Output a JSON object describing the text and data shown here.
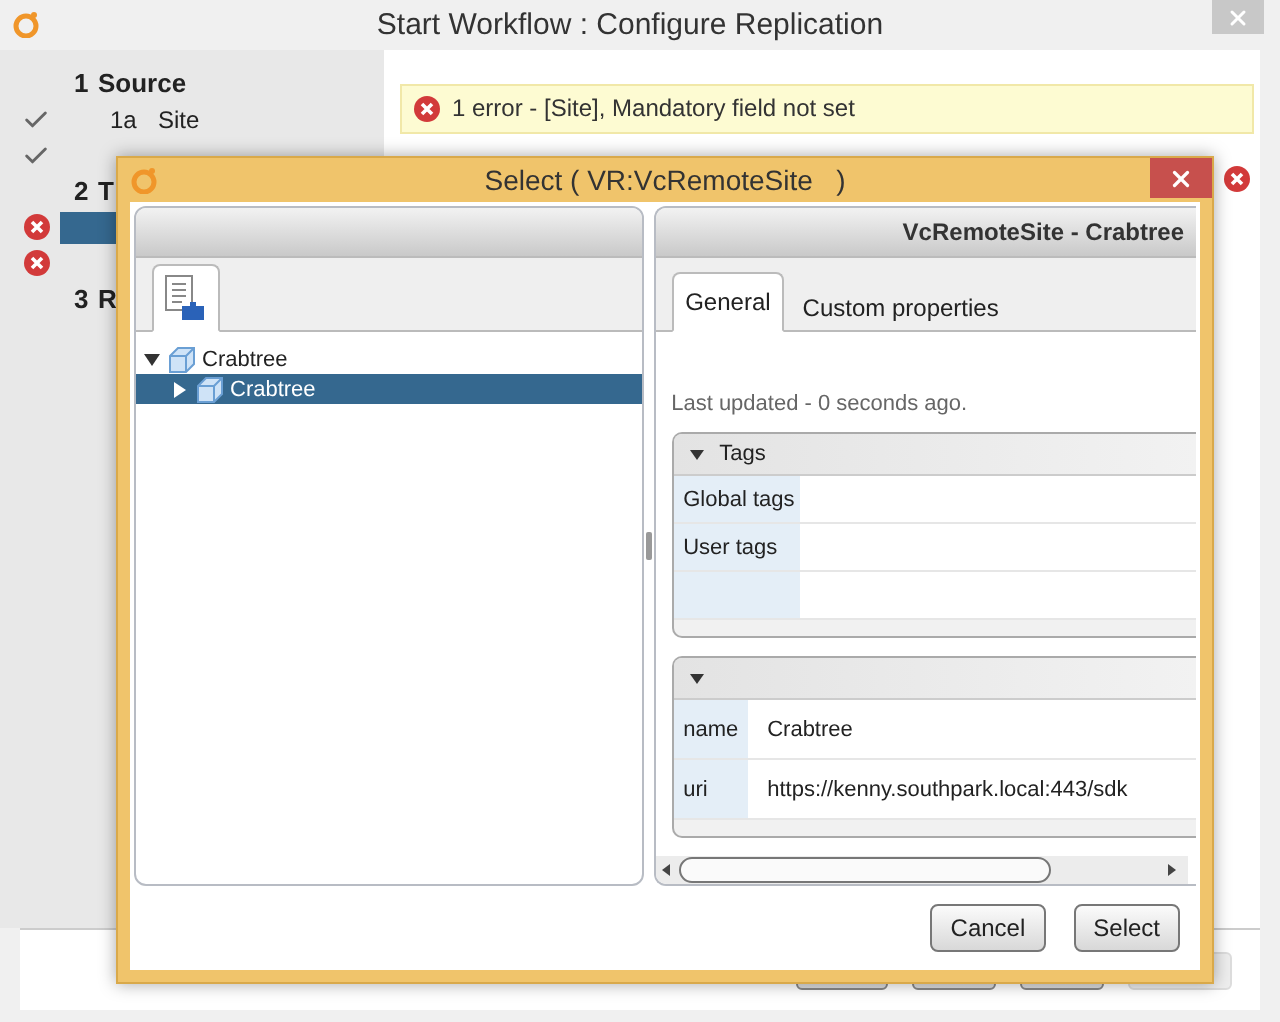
{
  "window": {
    "title": "Start Workflow : Configure Replication"
  },
  "sidebar": {
    "steps": [
      {
        "number": "1",
        "title": "Source",
        "substeps": [
          {
            "number": "1a",
            "label": "Site",
            "kind": "done",
            "selected": false
          },
          {
            "kind": "done",
            "selected": false
          }
        ]
      },
      {
        "number": "2",
        "title": "T",
        "substeps": [
          {
            "kind": "error",
            "selected": true
          },
          {
            "kind": "error",
            "selected": false
          }
        ]
      },
      {
        "number": "3",
        "title": "R"
      }
    ]
  },
  "error_banner": {
    "text": "1 error - [Site], Mandatory field not set"
  },
  "field": {
    "kind": "error"
  },
  "wizard_buttons": [
    {
      "disabled": false
    },
    {
      "disabled": false
    },
    {
      "disabled": false
    },
    {
      "disabled": true
    }
  ],
  "dialog": {
    "title": "Select ( VR:VcRemoteSite   )",
    "tree": [
      {
        "label": "Crabtree",
        "expanded": true,
        "selected": false,
        "children": [
          {
            "label": "Crabtree",
            "expanded": false,
            "selected": true
          }
        ]
      }
    ],
    "detail": {
      "header": "VcRemoteSite - Crabtree",
      "tabs": [
        {
          "label": "General",
          "selected": true
        },
        {
          "label": "Custom properties",
          "selected": false
        }
      ],
      "last_updated": "Last updated - 0 seconds ago.",
      "sections": [
        {
          "title": "Tags",
          "expanded": true,
          "rows": [
            {
              "key": "Global tags"
            },
            {
              "key": "User tags"
            }
          ]
        },
        {
          "expanded": true,
          "rows": [
            {
              "key": "name",
              "value": "Crabtree"
            },
            {
              "key": "uri",
              "value": "https://kenny.southpark.local:443/sdk"
            }
          ]
        }
      ]
    },
    "buttons": [
      "Cancel",
      "Select"
    ]
  }
}
